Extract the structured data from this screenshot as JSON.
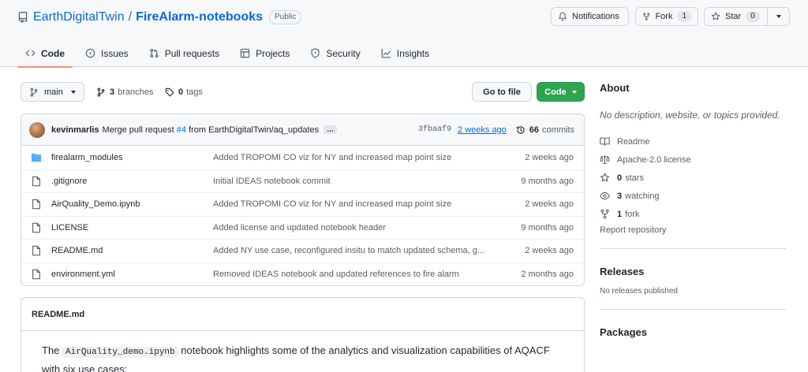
{
  "repo": {
    "owner": "EarthDigitalTwin",
    "name": "FireAlarm-notebooks",
    "visibility": "Public",
    "slash": "/"
  },
  "actions": {
    "notifications_label": "Notifications",
    "fork_label": "Fork",
    "fork_count": "1",
    "star_label": "Star",
    "star_count": "0"
  },
  "tabs": [
    {
      "label": "Code",
      "icon": "code-icon",
      "active": true
    },
    {
      "label": "Issues",
      "icon": "issue-icon"
    },
    {
      "label": "Pull requests",
      "icon": "pull-request-icon"
    },
    {
      "label": "Projects",
      "icon": "table-icon"
    },
    {
      "label": "Security",
      "icon": "shield-icon"
    },
    {
      "label": "Insights",
      "icon": "graph-icon"
    }
  ],
  "filenav": {
    "branch": "main",
    "branches_count": "3",
    "branches_label": "branches",
    "tags_count": "0",
    "tags_label": "tags",
    "goto_label": "Go to file",
    "code_label": "Code"
  },
  "latest_commit": {
    "author": "kevinmarlis",
    "message_prefix": "Merge pull request",
    "pr": "#4",
    "message_suffix": "from EarthDigitalTwin/aq_updates",
    "ellipsis": "…",
    "sha": "3fbaaf9",
    "when": "2 weeks ago",
    "commits_count": "66",
    "commits_label": "commits"
  },
  "files": [
    {
      "type": "folder",
      "name": "firealarm_modules",
      "message": "Added TROPOMI CO viz for NY and increased map point size",
      "age": "2 weeks ago"
    },
    {
      "type": "file",
      "name": ".gitignore",
      "message": "Initial IDEAS notebook commit",
      "age": "9 months ago"
    },
    {
      "type": "file",
      "name": "AirQuality_Demo.ipynb",
      "message": "Added TROPOMI CO viz for NY and increased map point size",
      "age": "2 weeks ago"
    },
    {
      "type": "file",
      "name": "LICENSE",
      "message": "Added license and updated notebook header",
      "age": "9 months ago"
    },
    {
      "type": "file",
      "name": "README.md",
      "message": "Added NY use case, reconfigured insitu to match updated schema, g...",
      "age": "2 weeks ago"
    },
    {
      "type": "file",
      "name": "environment.yml",
      "message": "Removed IDEAS notebook and updated references to fire alarm",
      "age": "2 months ago"
    }
  ],
  "readme": {
    "title": "README.md",
    "text_before": "The ",
    "code": "AirQuality_demo.ipynb",
    "text_after": " notebook highlights some of the analytics and visualization capabilities of AQACF with six use cases:"
  },
  "about": {
    "title": "About",
    "description": "No description, website, or topics provided.",
    "readme_label": "Readme",
    "license_label": "Apache-2.0 license",
    "stars_count": "0",
    "stars_label": "stars",
    "watching_count": "3",
    "watching_label": "watching",
    "forks_count": "1",
    "forks_label": "fork",
    "report_label": "Report repository"
  },
  "releases": {
    "title": "Releases",
    "note": "No releases published"
  },
  "packages": {
    "title": "Packages"
  }
}
